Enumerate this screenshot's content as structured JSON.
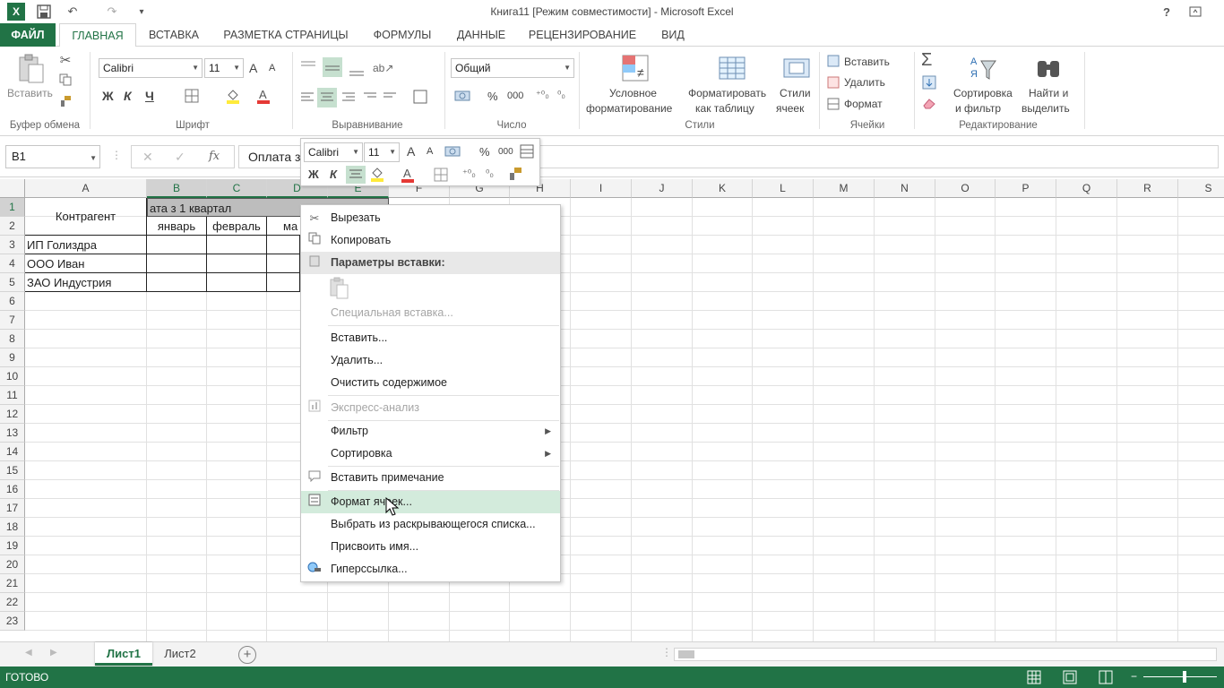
{
  "window": {
    "title": "Книга11  [Режим совместимости] - Microsoft Excel"
  },
  "titlebar_icons": {
    "help": "?",
    "excel_logo": "X",
    "save": "💾",
    "undo": "↶",
    "redo": "↷",
    "customize": "▾"
  },
  "tabs": [
    {
      "label": "ФАЙЛ"
    },
    {
      "label": "ГЛАВНАЯ"
    },
    {
      "label": "ВСТАВКА"
    },
    {
      "label": "РАЗМЕТКА СТРАНИЦЫ"
    },
    {
      "label": "ФОРМУЛЫ"
    },
    {
      "label": "ДАННЫЕ"
    },
    {
      "label": "РЕЦЕНЗИРОВАНИЕ"
    },
    {
      "label": "ВИД"
    }
  ],
  "ribbon": {
    "clipboard": {
      "paste": "Вставить",
      "label": "Буфер обмена"
    },
    "font": {
      "name": "Calibri",
      "size": "11",
      "bold": "Ж",
      "italic": "К",
      "underline": "Ч",
      "grow": "A",
      "shrink": "A",
      "label": "Шрифт"
    },
    "alignment": {
      "label": "Выравнивание"
    },
    "number": {
      "format": "Общий",
      "percent": "%",
      "thousands": "000",
      "label": "Число"
    },
    "styles": {
      "conditional1": "Условное",
      "conditional2": "форматирование",
      "table1": "Форматировать",
      "table2": "как таблицу",
      "cell1": "Стили",
      "cell2": "ячеек",
      "label": "Стили"
    },
    "cells": {
      "insert": "Вставить",
      "delete": "Удалить",
      "format": "Формат",
      "label": "Ячейки"
    },
    "editing": {
      "sort1": "Сортировка",
      "sort2": "и фильтр",
      "find1": "Найти и",
      "find2": "выделить",
      "label": "Редактирование"
    }
  },
  "formula_bar": {
    "namebox": "B1",
    "fx": "fx",
    "content": "Оплата з"
  },
  "grid": {
    "columns": [
      "A",
      "B",
      "C",
      "D",
      "E",
      "F",
      "G",
      "H",
      "I",
      "J",
      "K",
      "L",
      "M",
      "N",
      "O",
      "P",
      "Q",
      "R",
      "S"
    ],
    "rows": [
      "1",
      "2",
      "3",
      "4",
      "5",
      "6",
      "7",
      "8",
      "9",
      "10",
      "11",
      "12",
      "13",
      "14",
      "15",
      "16",
      "17",
      "18",
      "19",
      "20",
      "21",
      "22",
      "23"
    ],
    "cells": {
      "a1": "Контрагент",
      "b1": "ата з 1 квартал",
      "b2": "январь",
      "c2": "февраль",
      "d2": "ма",
      "a3": "ИП Голиздра",
      "a4": "ООО Иван",
      "a5": "ЗАО Индустрия"
    }
  },
  "mini_toolbar": {
    "font": "Calibri",
    "size": "11",
    "bold": "Ж",
    "italic": "К",
    "percent": "%",
    "thousands": "000"
  },
  "context_menu": {
    "items": [
      {
        "label": "Вырезать",
        "icon": "scissors-icon"
      },
      {
        "label": "Копировать",
        "icon": "copy-icon"
      },
      {
        "label": "Параметры вставки:",
        "icon": "paste-icon"
      },
      {
        "label": "Специальная вставка..."
      },
      {
        "label": "Вставить..."
      },
      {
        "label": "Удалить..."
      },
      {
        "label": "Очистить содержимое"
      },
      {
        "label": "Экспресс-анализ",
        "icon": "quick-analysis-icon"
      },
      {
        "label": "Фильтр"
      },
      {
        "label": "Сортировка"
      },
      {
        "label": "Вставить примечание",
        "icon": "comment-icon"
      },
      {
        "label": "Формат ячеек...",
        "icon": "format-cells-icon"
      },
      {
        "label": "Выбрать из раскрывающегося списка..."
      },
      {
        "label": "Присвоить имя..."
      },
      {
        "label": "Гиперссылка...",
        "icon": "hyperlink-icon"
      }
    ]
  },
  "sheets": [
    {
      "label": "Лист1"
    },
    {
      "label": "Лист2"
    }
  ],
  "status": {
    "text": "ГОТОВО"
  },
  "colors": {
    "accent": "#217346",
    "highlight": "#d3ebdc"
  }
}
